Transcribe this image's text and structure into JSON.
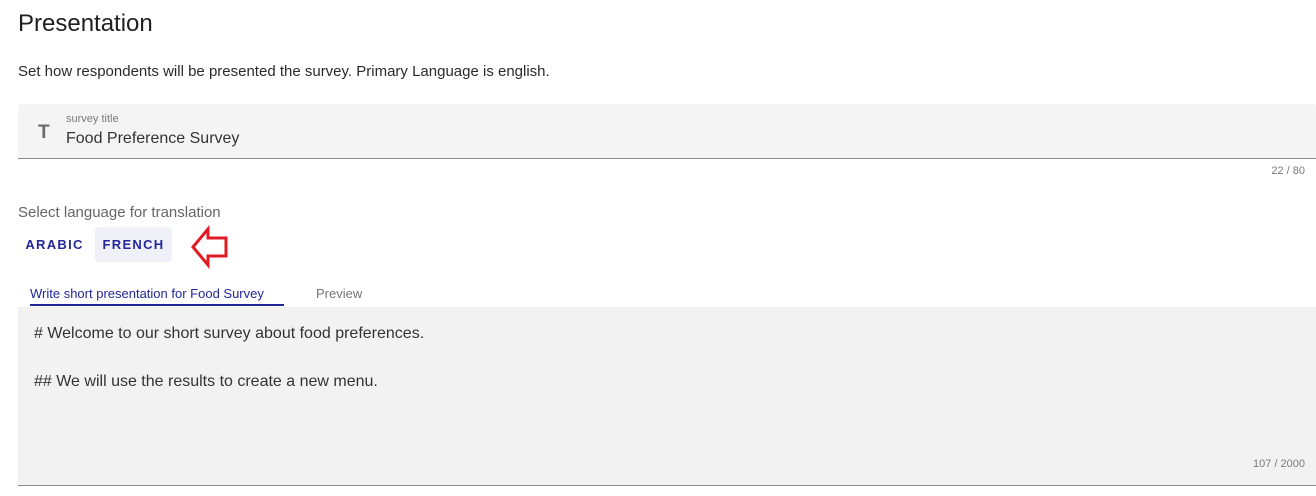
{
  "header": {
    "title": "Presentation",
    "description": "Set how respondents will be presented the survey. Primary Language is english."
  },
  "title_field": {
    "icon": "text-format-icon",
    "icon_glyph": "T",
    "label": "survey title",
    "value": "Food Preference Survey",
    "counter": "22 / 80"
  },
  "languages": {
    "label": "Select language for translation",
    "options": [
      "ARABIC",
      "FRENCH"
    ],
    "selected": "FRENCH"
  },
  "annotation": {
    "icon": "arrow-left-icon",
    "color": "#e01b24"
  },
  "tabs": {
    "write": "Write short presentation for Food Survey",
    "preview": "Preview",
    "active": "write"
  },
  "editor": {
    "lines": [
      "# Welcome to our short survey about food preferences.",
      "## We will use the results to create a new menu."
    ],
    "counter": "107 / 2000"
  },
  "colors": {
    "accent": "#23279a",
    "field_bg": "#f4f4f4"
  }
}
